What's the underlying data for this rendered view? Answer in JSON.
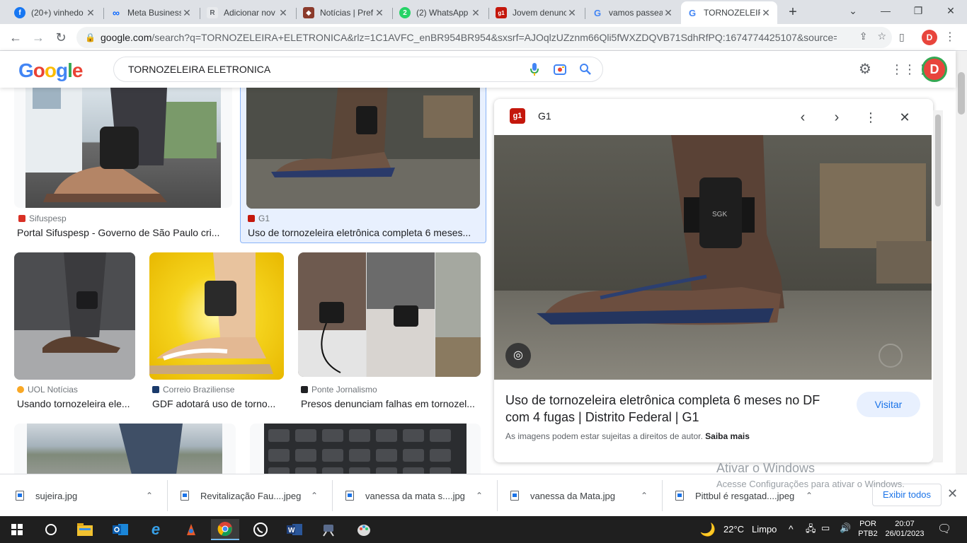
{
  "browser": {
    "tabs": [
      {
        "title": "(20+) vinhedo",
        "fav_color": "#1877f2",
        "fav_glyph": "f"
      },
      {
        "title": "Meta Business",
        "fav_color": "#0866ff",
        "fav_glyph": "∞"
      },
      {
        "title": "Adicionar nov",
        "fav_color": "#5f6368",
        "fav_glyph": "R"
      },
      {
        "title": "Notícias | Pref",
        "fav_color": "#8b3a2b",
        "fav_glyph": "◆"
      },
      {
        "title": "(2) WhatsApp",
        "fav_color": "#25d366",
        "fav_glyph": "2"
      },
      {
        "title": "Jovem denunc",
        "fav_color": "#c4170c",
        "fav_glyph": "g1"
      },
      {
        "title": "vamos passea",
        "fav_color": "#4285f4",
        "fav_glyph": "G"
      },
      {
        "title": "TORNOZELEIRA",
        "fav_color": "#4285f4",
        "fav_glyph": "G"
      }
    ],
    "url_host": "google.com",
    "url_rest": "/search?q=TORNOZELEIRA+ELETRONICA&rlz=1C1AVFC_enBR954BR954&sxsrf=AJOqlzUZznm66Qli5fWXZDQVB71SdhRfPQ:1674774425107&source=lnms&...",
    "profile_letter": "D"
  },
  "google": {
    "query": "TORNOZELEIRA ELETRONICA",
    "avatar_letter": "D"
  },
  "results": [
    {
      "source": "Sifuspesp",
      "caption": "Portal Sifuspesp - Governo de São Paulo cri...",
      "src_color": "#d93025"
    },
    {
      "source": "G1",
      "caption": "Uso de tornozeleira eletrônica completa 6 meses...",
      "src_color": "#c4170c"
    },
    {
      "source": "UOL Notícias",
      "caption": "Usando tornozeleira ele...",
      "src_color": "#f9a825"
    },
    {
      "source": "Correio Braziliense",
      "caption": "GDF adotará uso de torno...",
      "src_color": "#1a3a6b"
    },
    {
      "source": "Ponte Jornalismo",
      "caption": "Presos denunciam falhas em tornozel...",
      "src_color": "#202124"
    }
  ],
  "preview": {
    "source": "G1",
    "logo_text": "g1",
    "title": "Uso de tornozeleira eletrônica completa 6 meses no DF com 4 fugas | Distrito Federal | G1",
    "visit_label": "Visitar",
    "copyright_text": "As imagens podem estar sujeitas a direitos de autor.",
    "learn_more": "Saiba mais"
  },
  "watermark": {
    "line1": "Ativar o Windows",
    "line2": "Acesse Configurações para ativar o Windows."
  },
  "downloads": {
    "items": [
      "sujeira.jpg",
      "Revitalização Fau....jpeg",
      "vanessa da mata s....jpg",
      "vanessa da Mata.jpg",
      "Pittbul é resgatad....jpeg"
    ],
    "show_all": "Exibir todos"
  },
  "taskbar": {
    "temperature": "22°C",
    "weather": "Limpo",
    "lang1": "POR",
    "lang2": "PTB2",
    "time": "20:07",
    "date": "26/01/2023"
  }
}
